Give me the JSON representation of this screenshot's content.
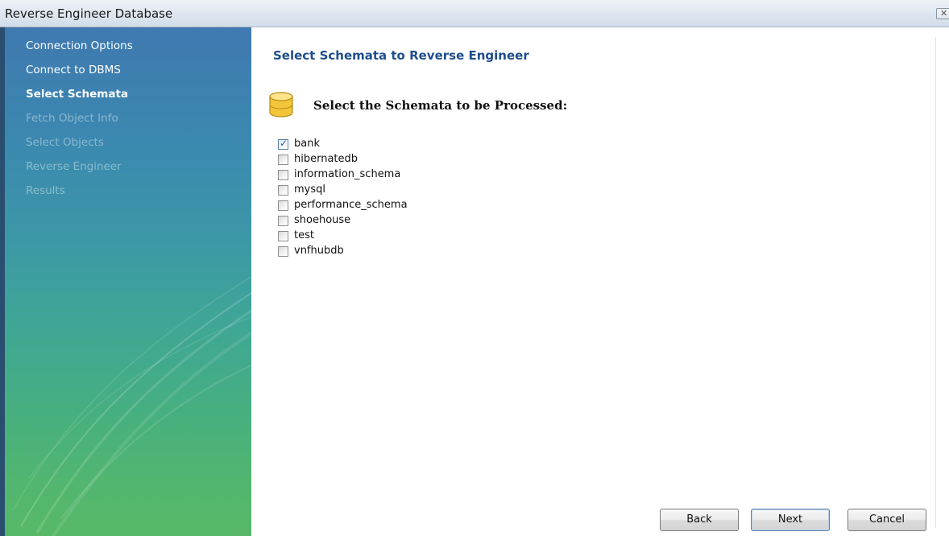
{
  "window": {
    "title": "Reverse Engineer Database",
    "close_glyph": "✕"
  },
  "steps": [
    {
      "label": "Connection Options",
      "state": "done"
    },
    {
      "label": "Connect to DBMS",
      "state": "done"
    },
    {
      "label": "Select Schemata",
      "state": "current"
    },
    {
      "label": "Fetch Object Info",
      "state": "pending"
    },
    {
      "label": "Select Objects",
      "state": "pending"
    },
    {
      "label": "Reverse Engineer",
      "state": "pending"
    },
    {
      "label": "Results",
      "state": "pending"
    }
  ],
  "page": {
    "title": "Select Schemata to Reverse Engineer",
    "section_heading": "Select the Schemata to be Processed:",
    "section_icon": "database-icon"
  },
  "schemata": [
    {
      "name": "bank",
      "checked": true
    },
    {
      "name": "hibernatedb",
      "checked": false
    },
    {
      "name": "information_schema",
      "checked": false
    },
    {
      "name": "mysql",
      "checked": false
    },
    {
      "name": "performance_schema",
      "checked": false
    },
    {
      "name": "shoehouse",
      "checked": false
    },
    {
      "name": "test",
      "checked": false
    },
    {
      "name": "vnfhubdb",
      "checked": false
    }
  ],
  "buttons": {
    "back": "Back",
    "next": "Next",
    "cancel": "Cancel"
  },
  "colors": {
    "title_text": "#1f4e8c",
    "sidebar_top": "#3f79b0",
    "sidebar_bottom": "#57b867"
  }
}
